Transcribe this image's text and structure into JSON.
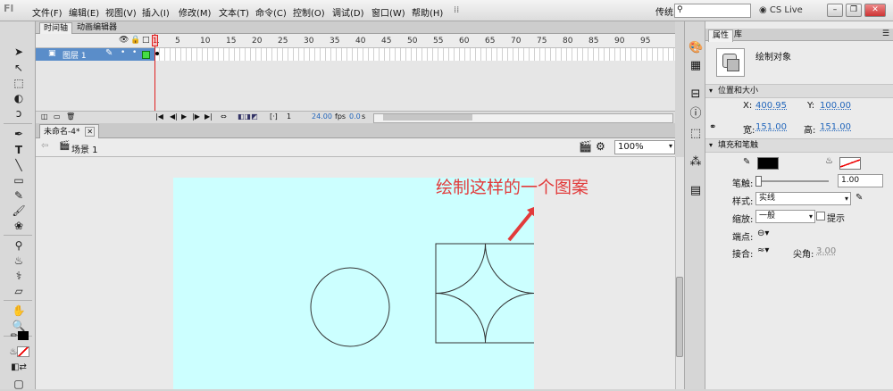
{
  "app": {
    "logo": "Fl"
  },
  "menu": {
    "items": [
      "文件(F)",
      "编辑(E)",
      "视图(V)",
      "插入(I)",
      "修改(M)",
      "文本(T)",
      "命令(C)",
      "控制(O)",
      "调试(D)",
      "窗口(W)",
      "帮助(H)"
    ]
  },
  "topbar": {
    "workspace": "传统",
    "cs_live": "CS Live"
  },
  "timeline": {
    "tabs": [
      "时间轴",
      "动画编辑器"
    ],
    "ruler": [
      "1",
      "5",
      "10",
      "15",
      "20",
      "25",
      "30",
      "35",
      "40",
      "45",
      "50",
      "55",
      "60",
      "65",
      "70",
      "75",
      "80",
      "85",
      "90",
      "95"
    ],
    "layer_name": "图层 1",
    "fps": "24.00",
    "fps_unit": "fps",
    "time": "0.0",
    "time_unit": "s",
    "current_frame": "1"
  },
  "document": {
    "tab_title": "未命名-4*",
    "scene": "场景 1",
    "zoom": "100%"
  },
  "annotation": {
    "text": "绘制这样的一个图案",
    "color": "#e23b3b"
  },
  "properties": {
    "tabs": [
      "属性",
      "库"
    ],
    "object_type": "绘制对象",
    "position_section": "位置和大小",
    "x_label": "X:",
    "x_value": "400.95",
    "y_label": "Y:",
    "y_value": "100.00",
    "w_label": "宽:",
    "w_value": "151.00",
    "h_label": "高:",
    "h_value": "151.00",
    "fill_section": "填充和笔触",
    "stroke_label": "笔触:",
    "stroke_value": "1.00",
    "style_label": "样式:",
    "style_value": "实线",
    "scale_label": "缩放:",
    "scale_value": "一般",
    "hint_label": "提示",
    "cap_label": "端点:",
    "join_label": "接合:",
    "miter_label": "尖角:",
    "miter_value": "3.00"
  },
  "colors": {
    "stage": "#ccffff",
    "stroke_color": "#000000",
    "fill_color": "none"
  }
}
